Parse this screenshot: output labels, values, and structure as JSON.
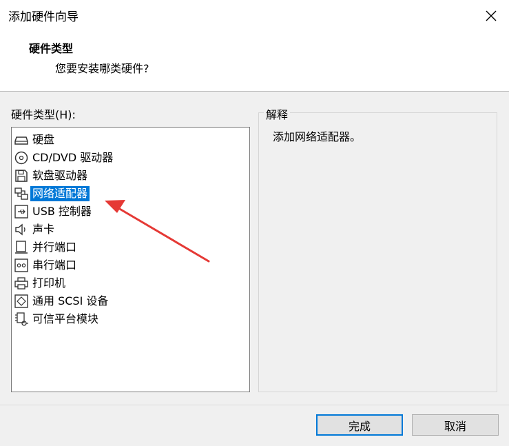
{
  "window": {
    "title": "添加硬件向导",
    "close_icon": "close-icon"
  },
  "header": {
    "title": "硬件类型",
    "subtitle": "您要安装哪类硬件?"
  },
  "list": {
    "label": "硬件类型(H):",
    "selected": "网络适配器",
    "items": [
      {
        "label": "硬盘",
        "icon": "hard-disk-icon"
      },
      {
        "label": "CD/DVD 驱动器",
        "icon": "cd-dvd-icon"
      },
      {
        "label": "软盘驱动器",
        "icon": "floppy-icon"
      },
      {
        "label": "网络适配器",
        "icon": "network-adapter-icon"
      },
      {
        "label": "USB 控制器",
        "icon": "usb-icon"
      },
      {
        "label": "声卡",
        "icon": "speaker-icon"
      },
      {
        "label": "并行端口",
        "icon": "parallel-port-icon"
      },
      {
        "label": "串行端口",
        "icon": "serial-port-icon"
      },
      {
        "label": "打印机",
        "icon": "printer-icon"
      },
      {
        "label": "通用 SCSI 设备",
        "icon": "scsi-icon"
      },
      {
        "label": "可信平台模块",
        "icon": "tpm-icon"
      }
    ]
  },
  "explanation": {
    "title": "解释",
    "text": "添加网络适配器。"
  },
  "buttons": {
    "finish": "完成",
    "cancel": "取消"
  },
  "colors": {
    "selection": "#0078d7",
    "annotation_arrow": "#e53935"
  }
}
